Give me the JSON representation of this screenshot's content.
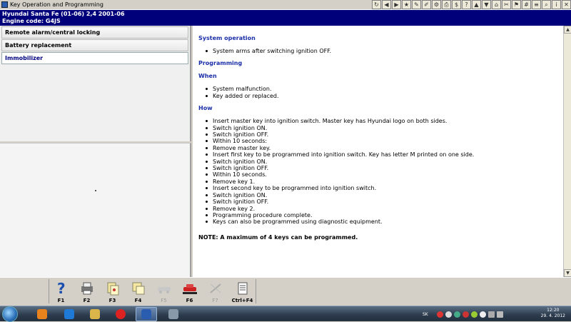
{
  "window": {
    "title": "Key Operation and Programming"
  },
  "vehicle": {
    "line1": "Hyundai   Santa Fe (01-06) 2,4  2001-06",
    "line2": "Engine code: G4JS"
  },
  "toolbar_icons": [
    "refresh-icon",
    "back-icon",
    "forward-icon",
    "bookmark-icon",
    "notes-icon",
    "edit-icon",
    "settings-icon",
    "print-icon",
    "dollar-icon",
    "help-icon",
    "arrow-up-icon",
    "arrow-down-icon",
    "home-icon",
    "tools-icon",
    "flag-icon",
    "calculator-icon",
    "chart-icon",
    "zoom-icon",
    "info-icon",
    "exit-icon"
  ],
  "nav": {
    "items": [
      {
        "label": "Remote alarm/central locking",
        "active": false
      },
      {
        "label": "Battery replacement",
        "active": false
      },
      {
        "label": "Immobilizer",
        "active": true
      }
    ]
  },
  "content": {
    "system_operation_heading": "System operation",
    "system_operation": [
      "System arms after switching ignition OFF."
    ],
    "programming_heading": "Programming",
    "when_heading": "When",
    "when": [
      "System malfunction.",
      "Key added or replaced."
    ],
    "how_heading": "How",
    "how": [
      "Insert master key into ignition switch. Master key has Hyundai logo on both sides.",
      "Switch ignition ON.",
      "Switch ignition OFF.",
      "Within 10 seconds:",
      "Remove master key.",
      "Insert first key to be programmed into ignition switch. Key has letter M printed on one side.",
      "Switch ignition ON.",
      "Switch ignition OFF.",
      "Within 10 seconds.",
      "Remove key 1.",
      "Insert second key to be programmed into ignition switch.",
      "Switch ignition ON.",
      "Switch ignition OFF.",
      "Remove key 2.",
      "Programming procedure complete.",
      "Keys can also be programmed using diagnostic equipment."
    ],
    "note": "NOTE: A maximum of 4 keys can be programmed."
  },
  "fkeys": [
    {
      "label": "F1",
      "icon": "help-icon",
      "enabled": true
    },
    {
      "label": "F2",
      "icon": "print-icon",
      "enabled": true
    },
    {
      "label": "F3",
      "icon": "document-icon",
      "enabled": true
    },
    {
      "label": "F4",
      "icon": "copy-icon",
      "enabled": true
    },
    {
      "label": "F5",
      "icon": "car-icon",
      "enabled": false
    },
    {
      "label": "F6",
      "icon": "car-diagnostic-icon",
      "enabled": true
    },
    {
      "label": "F7",
      "icon": "tools-icon",
      "enabled": false
    },
    {
      "label": "Ctrl+F4",
      "icon": "notes-icon",
      "enabled": true
    }
  ],
  "taskbar": {
    "apps": [
      "media-player-icon",
      "internet-explorer-icon",
      "file-explorer-icon",
      "opera-icon",
      "autodata-icon",
      "settings-app-icon"
    ],
    "language": "SK",
    "time": "12:20",
    "date": "29. 4. 2012"
  }
}
